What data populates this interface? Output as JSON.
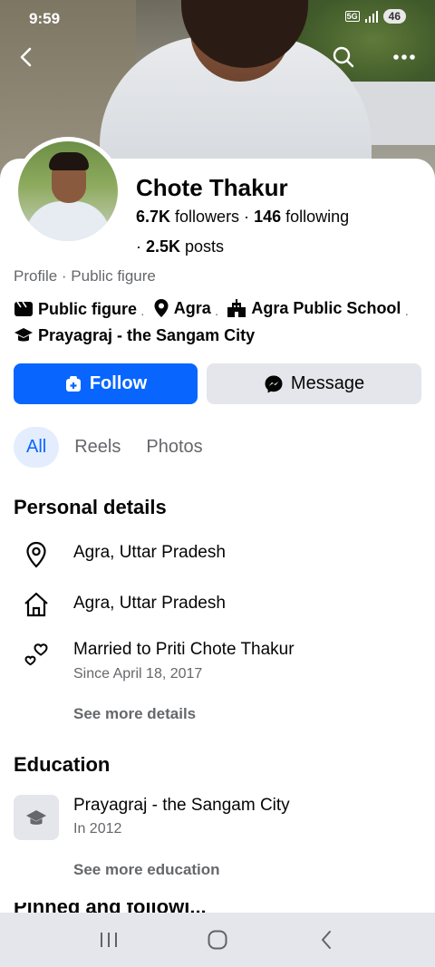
{
  "status_bar": {
    "time": "9:59",
    "network": "5G",
    "battery": "46"
  },
  "profile": {
    "name": "Chote Thakur",
    "followers_count": "6.7K",
    "followers_label": " followers · ",
    "following_count": "146",
    "following_label": " following",
    "posts_prefix": "· ",
    "posts_count": "2.5K",
    "posts_label": " posts",
    "category": "Profile · Public figure"
  },
  "intro": {
    "items": [
      {
        "icon": "page-icon",
        "label": "Public figure"
      },
      {
        "icon": "location-pin-icon",
        "label": "Agra"
      },
      {
        "icon": "school-icon",
        "label": "Agra Public School"
      },
      {
        "icon": "graduation-cap-icon",
        "label": "Prayagraj - the Sangam City"
      }
    ],
    "separator": "·"
  },
  "actions": {
    "follow_label": "Follow",
    "message_label": "Message"
  },
  "tabs": [
    {
      "label": "All",
      "active": true
    },
    {
      "label": "Reels",
      "active": false
    },
    {
      "label": "Photos",
      "active": false
    }
  ],
  "personal_details": {
    "title": "Personal details",
    "current_city": "Agra, Uttar Pradesh",
    "hometown": "Agra, Uttar Pradesh",
    "relationship": "Married to Priti Chote Thakur",
    "relationship_since": "Since April 18, 2017",
    "see_more": "See more details"
  },
  "education": {
    "title": "Education",
    "school": "Prayagraj - the Sangam City",
    "year": "In 2012",
    "see_more": "See more education"
  },
  "next_section_partial": "Pinned and followi...",
  "colors": {
    "brand_blue": "#0866ff",
    "secondary_text": "#65676b",
    "button_gray": "#e4e6eb",
    "active_tab_bg": "#e3edfd"
  }
}
